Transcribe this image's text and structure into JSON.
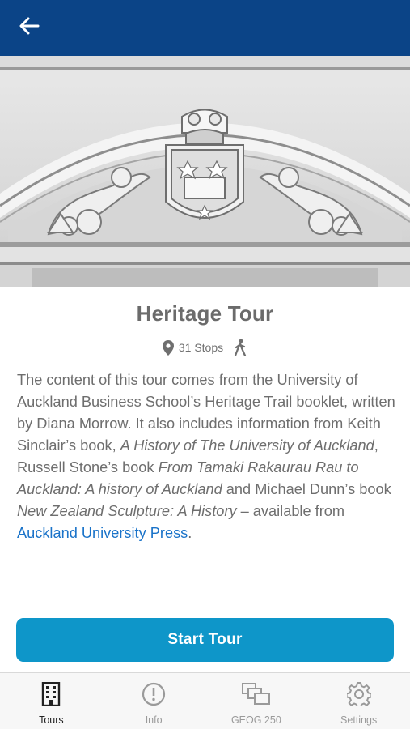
{
  "header": {
    "back_icon": "arrow-left-icon",
    "bg_color": "#0b4487"
  },
  "hero": {
    "image_subject": "stone carved university crest pediment"
  },
  "tour": {
    "title": "Heritage Tour",
    "stops": "31 Stops",
    "stops_icon": "location-pin-icon",
    "mode_icon": "walking-icon",
    "desc": {
      "t1": "The content of this tour comes from the University of Auckland Business School’s Heritage Trail booklet, written by Diana Morrow. It also includes information from Keith Sinclair’s book, ",
      "i1": "A History of The University of Auckland",
      "t2": ", Russell Stone’s book ",
      "i2": "From Tamaki Rakaurau Rau to Auckland: A history of Auckland",
      "t3": " and Michael Dunn’s book ",
      "i3": "New Zealand Sculpture: A History",
      "t4": " – available from ",
      "link": "Auckland University Press",
      "t5": "."
    }
  },
  "start_button": {
    "label": "Start Tour",
    "color": "#0e96c9"
  },
  "tabs": [
    {
      "label": "Tours",
      "icon": "building-icon",
      "active": true
    },
    {
      "label": "Info",
      "icon": "info-circle-icon",
      "active": false
    },
    {
      "label": "GEOG 250",
      "icon": "gallery-icon",
      "active": false
    },
    {
      "label": "Settings",
      "icon": "gear-icon",
      "active": false
    }
  ]
}
